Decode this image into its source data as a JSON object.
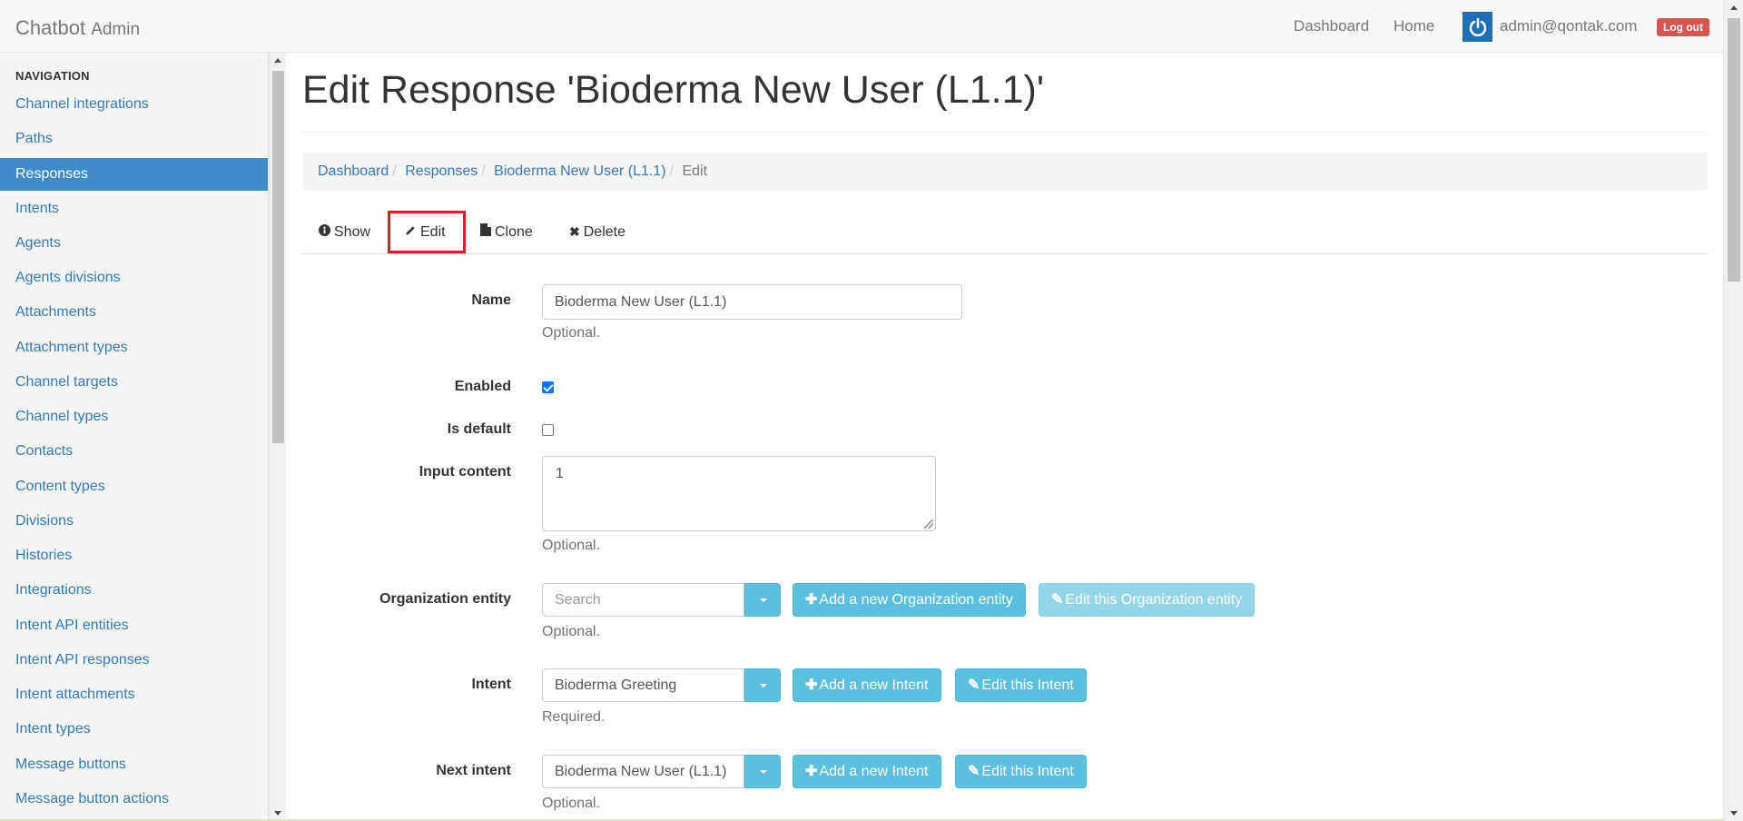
{
  "navbar": {
    "brand": "Chatbot",
    "brand_sub": "Admin",
    "links": [
      "Dashboard",
      "Home"
    ],
    "user_email": "admin@qontak.com",
    "logout_label": "Log out"
  },
  "sidebar": {
    "header": "NAVIGATION",
    "items": [
      {
        "label": "Channel integrations",
        "active": false
      },
      {
        "label": "Paths",
        "active": false
      },
      {
        "label": "Responses",
        "active": true
      },
      {
        "label": "Intents",
        "active": false
      },
      {
        "label": "Agents",
        "active": false
      },
      {
        "label": "Agents divisions",
        "active": false
      },
      {
        "label": "Attachments",
        "active": false
      },
      {
        "label": "Attachment types",
        "active": false
      },
      {
        "label": "Channel targets",
        "active": false
      },
      {
        "label": "Channel types",
        "active": false
      },
      {
        "label": "Contacts",
        "active": false
      },
      {
        "label": "Content types",
        "active": false
      },
      {
        "label": "Divisions",
        "active": false
      },
      {
        "label": "Histories",
        "active": false
      },
      {
        "label": "Integrations",
        "active": false
      },
      {
        "label": "Intent API entities",
        "active": false
      },
      {
        "label": "Intent API responses",
        "active": false
      },
      {
        "label": "Intent attachments",
        "active": false
      },
      {
        "label": "Intent types",
        "active": false
      },
      {
        "label": "Message buttons",
        "active": false
      },
      {
        "label": "Message button actions",
        "active": false
      }
    ]
  },
  "main": {
    "title": "Edit Response 'Bioderma New User (L1.1)'",
    "breadcrumb": {
      "items": [
        "Dashboard",
        "Responses",
        "Bioderma New User (L1.1)"
      ],
      "current": "Edit"
    },
    "tabs": {
      "show": "Show",
      "edit": "Edit",
      "clone": "Clone",
      "delete": "Delete"
    },
    "form": {
      "name": {
        "label": "Name",
        "value": "Bioderma New User (L1.1)",
        "help": "Optional."
      },
      "enabled": {
        "label": "Enabled",
        "checked": true
      },
      "is_default": {
        "label": "Is default",
        "checked": false
      },
      "input_content": {
        "label": "Input content",
        "value": "1",
        "help": "Optional."
      },
      "organization_entity": {
        "label": "Organization entity",
        "placeholder": "Search",
        "add_label": "Add a new Organization entity",
        "edit_label": "Edit this Organization entity",
        "help": "Optional."
      },
      "intent": {
        "label": "Intent",
        "value": "Bioderma Greeting",
        "add_label": "Add a new Intent",
        "edit_label": "Edit this Intent",
        "help": "Required."
      },
      "next_intent": {
        "label": "Next intent",
        "value": "Bioderma New User (L1.1)",
        "add_label": "Add a new Intent",
        "edit_label": "Edit this Intent",
        "help": "Optional."
      }
    }
  }
}
